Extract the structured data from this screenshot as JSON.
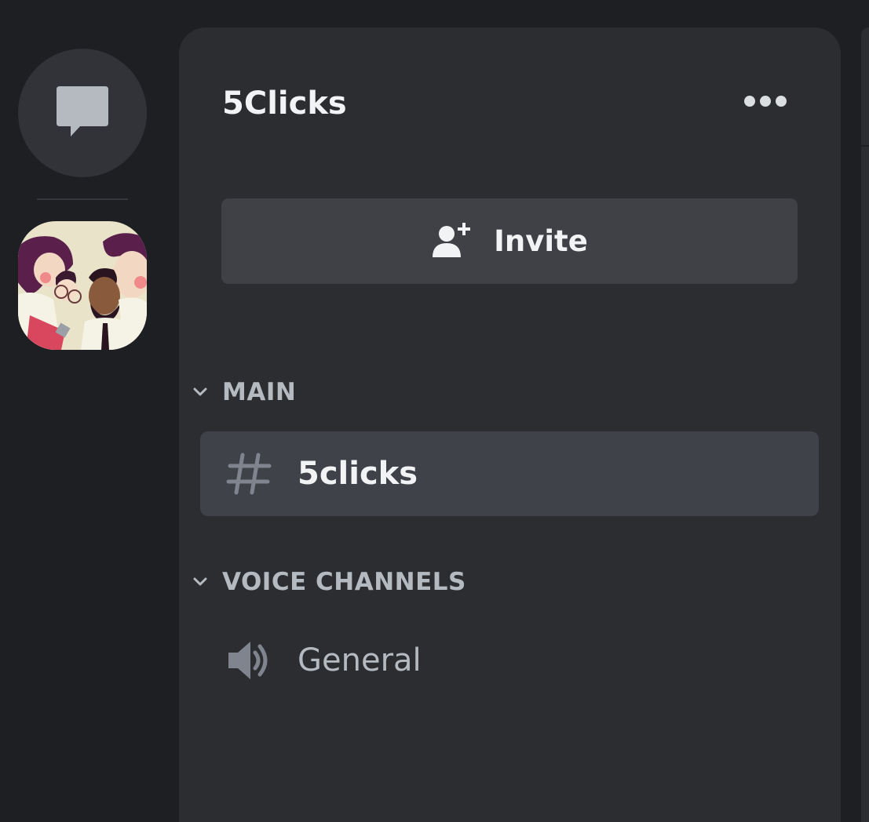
{
  "server": {
    "name": "5Clicks",
    "invite_label": "Invite"
  },
  "categories": [
    {
      "label": "MAIN",
      "channels": [
        {
          "label": "5clicks",
          "type": "text",
          "active": true
        }
      ]
    },
    {
      "label": "VOICE CHANNELS",
      "channels": [
        {
          "label": "General",
          "type": "voice",
          "active": false
        }
      ]
    }
  ],
  "icons": {
    "direct_messages": "chat-bubble-icon",
    "more": "ellipsis-icon",
    "invite": "add-user-icon",
    "category_toggle": "chevron-down-icon",
    "text_channel": "hash-icon",
    "voice_channel": "speaker-icon"
  },
  "colors": {
    "background": "#1e1f22",
    "panel": "#2b2d31",
    "active_channel": "#404249",
    "button": "#3f4147",
    "text_primary": "#f2f3f5",
    "text_muted": "#b5bac1"
  }
}
